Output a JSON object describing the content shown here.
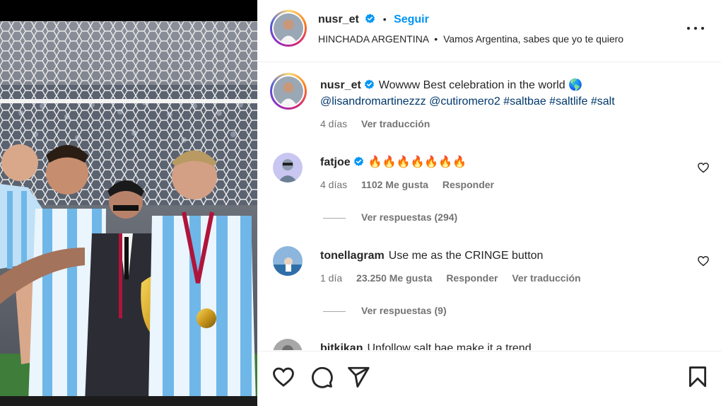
{
  "post": {
    "username": "nusr_et",
    "separator": "•",
    "follow_label": "Seguir",
    "audio_artist": "HINCHADA ARGENTINA",
    "audio_separator": "•",
    "audio_title": "Vamos Argentina, sabes que yo te quiero"
  },
  "caption": {
    "username": "nusr_et",
    "text": "Wowww Best celebration in the world 🌎",
    "tags": "@lisandromartinezzz @cutiromero2 #saltbae #saltlife #salt",
    "time": "4 días",
    "translate": "Ver traducción"
  },
  "comments": [
    {
      "username": "fatjoe",
      "text": "🔥🔥🔥🔥🔥🔥🔥",
      "time": "4 días",
      "likes": "1102 Me gusta",
      "reply": "Responder",
      "view_replies": "Ver respuestas (294)"
    },
    {
      "username": "tonellagram",
      "text": "Use me as the CRINGE button",
      "time": "1 día",
      "likes": "23.250 Me gusta",
      "reply": "Responder",
      "translate": "Ver traducción",
      "view_replies": "Ver respuestas (9)"
    },
    {
      "username": "bitkikan",
      "text": "Unfollow salt bae make it a trend"
    }
  ],
  "icons": {
    "like": "heart-icon",
    "comment": "comment-bubble-icon",
    "share": "paper-plane-icon",
    "save": "bookmark-icon",
    "more": "more-options-icon",
    "verified": "verified-badge-icon"
  },
  "colors": {
    "accent": "#0095f6",
    "verified": "#0095f6",
    "text": "#262626",
    "muted": "#737373",
    "tag": "#00376b"
  }
}
